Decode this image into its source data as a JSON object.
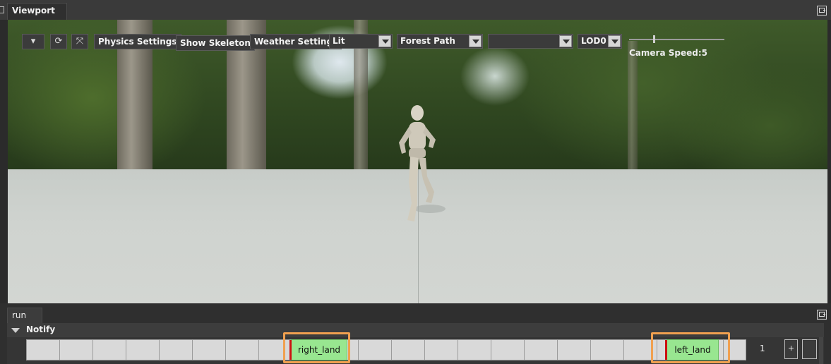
{
  "viewport": {
    "tab_label": "Viewport",
    "toolbar": {
      "physics_label": "Physics Settings",
      "skeleton_label": "Show Skeleton",
      "weather_label": "Weather Settings",
      "render_mode_value": "Lit",
      "environment_value": "Forest Path",
      "extra_value": "",
      "lod_value": "LOD0",
      "camera_speed_label": "Camera Speed:5"
    }
  },
  "timeline": {
    "tab_label": "run",
    "track_label": "Notify",
    "notifies": [
      {
        "label": "right_land"
      },
      {
        "label": "left_land"
      }
    ],
    "frame_value": "1",
    "add_label": "+"
  },
  "colors": {
    "notify_fill": "#98e690",
    "highlight": "#f0a050",
    "marker": "#cc1111"
  }
}
